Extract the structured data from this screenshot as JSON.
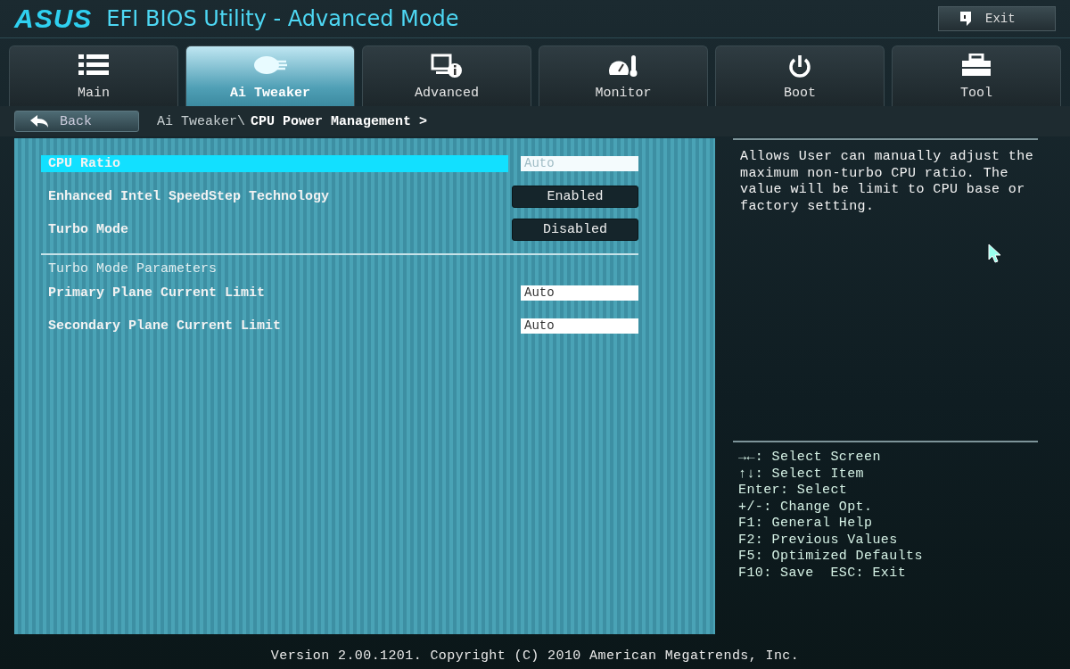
{
  "header": {
    "logo": "ASUS",
    "title": "EFI BIOS Utility - Advanced Mode",
    "exit_button": "Exit"
  },
  "tabs": [
    {
      "label": "Main",
      "selected": false
    },
    {
      "label": "Ai Tweaker",
      "selected": true
    },
    {
      "label": "Advanced",
      "selected": false
    },
    {
      "label": "Monitor",
      "selected": false
    },
    {
      "label": "Boot",
      "selected": false
    },
    {
      "label": "Tool",
      "selected": false
    }
  ],
  "back_button": "Back",
  "breadcrumb": {
    "path": "Ai Tweaker\\",
    "current": "CPU Power Management >"
  },
  "settings": [
    {
      "kind": "field",
      "label": "CPU Ratio",
      "value": "Auto",
      "selected": true
    },
    {
      "kind": "option",
      "label": "Enhanced Intel SpeedStep Technology",
      "value": "Enabled",
      "selected": false
    },
    {
      "kind": "option",
      "label": "Turbo Mode",
      "value": "Disabled",
      "selected": false
    },
    {
      "kind": "section",
      "label": "Turbo Mode Parameters"
    },
    {
      "kind": "field",
      "label": "Primary Plane Current Limit",
      "value": "Auto",
      "selected": false
    },
    {
      "kind": "field",
      "label": "Secondary Plane Current Limit",
      "value": "Auto",
      "selected": false
    }
  ],
  "help_text": "Allows User can manually adjust the maximum non-turbo CPU ratio. The value will be limit to CPU base or factory setting.",
  "key_hints": [
    "→←: Select Screen",
    "↑↓: Select Item",
    "Enter: Select",
    "+/-: Change Opt.",
    "F1: General Help",
    "F2: Previous Values",
    "F5: Optimized Defaults",
    "F10: Save  ESC: Exit"
  ],
  "footer": "Version 2.00.1201. Copyright (C) 2010 American Megatrends, Inc."
}
